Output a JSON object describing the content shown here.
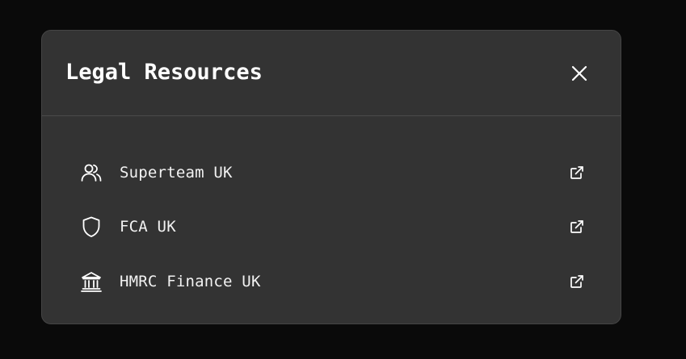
{
  "modal": {
    "title": "Legal Resources",
    "close_icon": "close-icon"
  },
  "links": [
    {
      "label": "Superteam UK",
      "icon": "users-icon",
      "action_icon": "external-link-icon"
    },
    {
      "label": "FCA UK",
      "icon": "shield-icon",
      "action_icon": "external-link-icon"
    },
    {
      "label": "HMRC Finance UK",
      "icon": "bank-icon",
      "action_icon": "external-link-icon"
    }
  ],
  "colors": {
    "backdrop": "#0a0a0a",
    "modal_bg": "#333333",
    "text": "#ffffff"
  }
}
